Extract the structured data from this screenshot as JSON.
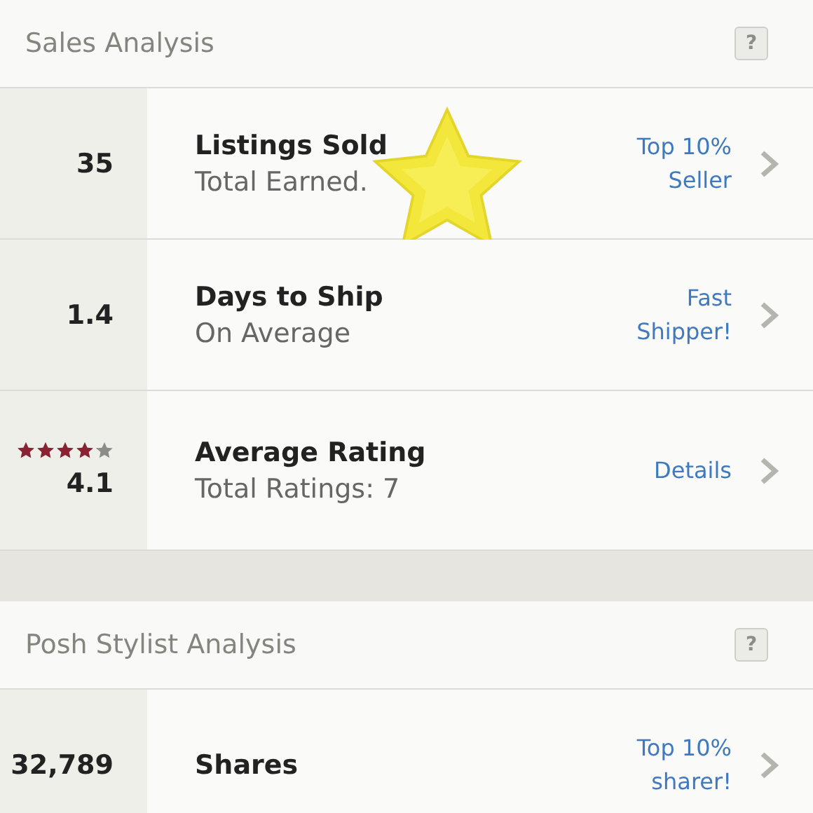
{
  "sections": [
    {
      "title": "Sales Analysis",
      "help": "?",
      "rows": [
        {
          "kind": "stat",
          "value": "35",
          "title": "Listings Sold",
          "subtitle": "Total Earned.",
          "badge": "Top 10%\nSeller",
          "highlight": true
        },
        {
          "kind": "stat",
          "value": "1.4",
          "title": "Days to Ship",
          "subtitle": "On Average",
          "badge": "Fast\nShipper!",
          "highlight": false
        },
        {
          "kind": "rating",
          "stars": 4.1,
          "value": "4.1",
          "title": "Average Rating",
          "subtitle": "Total Ratings: 7",
          "badge": "Details",
          "highlight": false
        }
      ]
    },
    {
      "title": "Posh Stylist Analysis",
      "help": "?",
      "rows": [
        {
          "kind": "stat",
          "value": "32,789",
          "title": "Shares",
          "badge": "Top 10%\nsharer!",
          "highlight": false
        }
      ]
    }
  ]
}
